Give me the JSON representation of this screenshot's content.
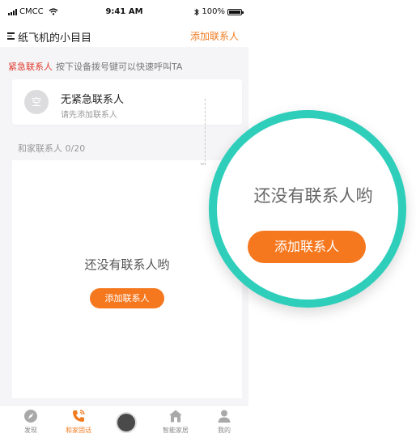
{
  "statusbar": {
    "carrier": "CMCC",
    "time": "9:41 AM",
    "battery": "100%"
  },
  "navbar": {
    "title": "纸飞机的小目目",
    "action": "添加联系人"
  },
  "emergency": {
    "label": "紧急联系人",
    "hint": "按下设备拨号键可以快速呼叫TA",
    "card": {
      "avatar_text": "空",
      "title": "无紧急联系人",
      "subtitle": "请先添加联系人"
    }
  },
  "family": {
    "header": "和家联系人 0/20",
    "empty_text": "还没有联系人哟",
    "add_button": "添加联系人"
  },
  "tabs": [
    {
      "label": "发现",
      "icon": "compass-icon",
      "active": false
    },
    {
      "label": "和家固话",
      "icon": "phone-icon",
      "active": true
    },
    {
      "label": "",
      "icon": "avatar",
      "active": false
    },
    {
      "label": "智能家居",
      "icon": "home-icon",
      "active": false
    },
    {
      "label": "我的",
      "icon": "user-icon",
      "active": false
    }
  ],
  "zoom": {
    "empty_text": "还没有联系人哟",
    "add_button": "添加联系人"
  },
  "colors": {
    "accent": "#f5781f",
    "highlight_ring": "#2fcebb",
    "emergency_red": "#e03a2e"
  }
}
